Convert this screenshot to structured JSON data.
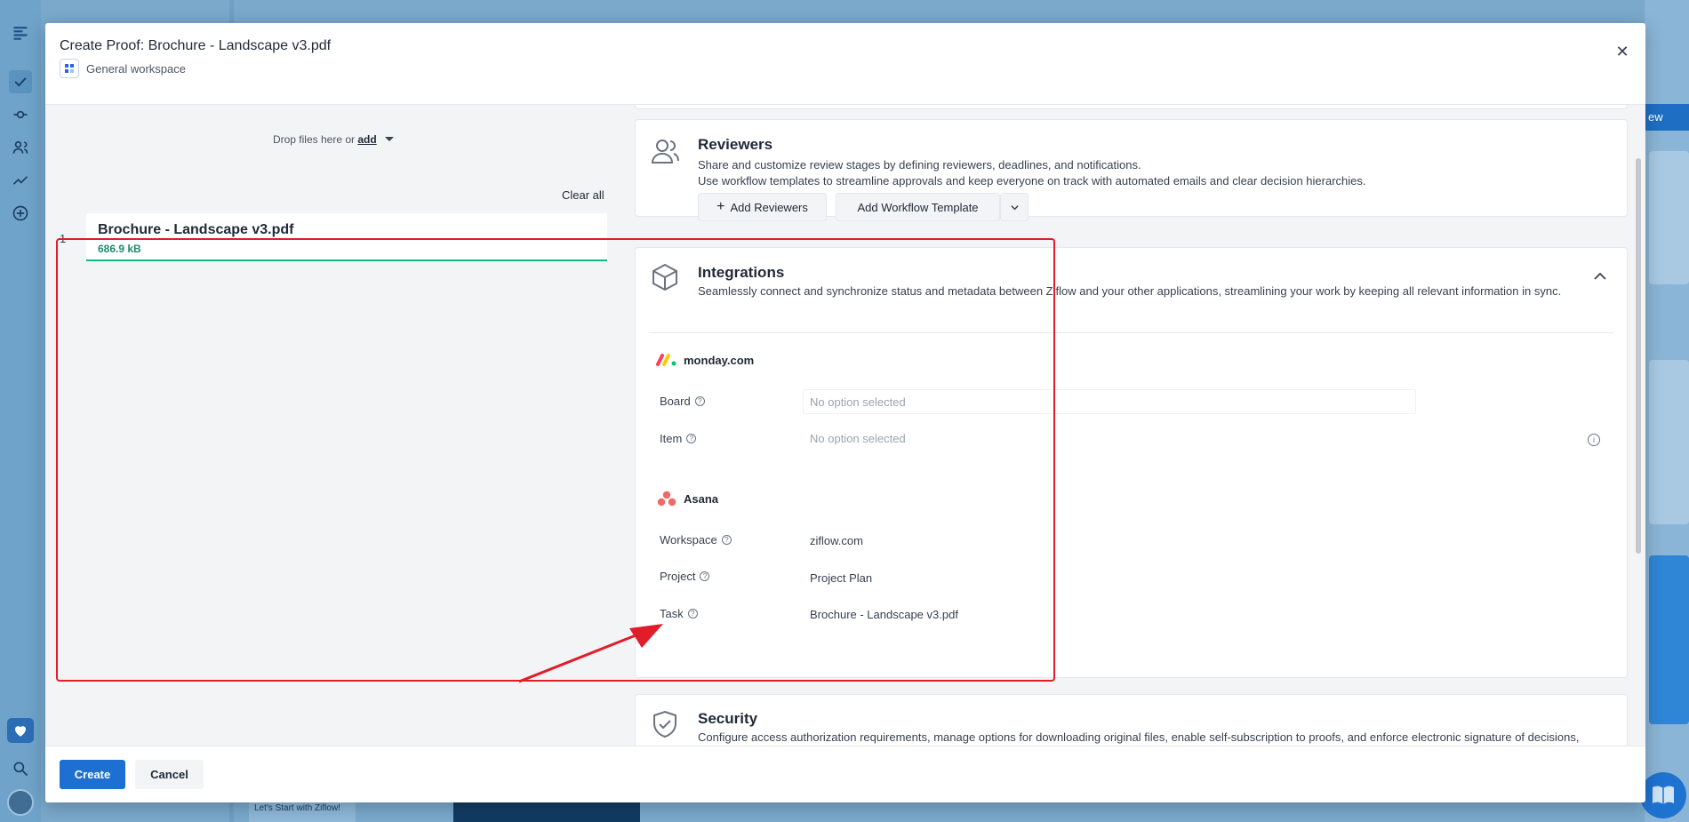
{
  "modal": {
    "title": "Create Proof:  Brochure - Landscape v3.pdf",
    "workspace": "General workspace",
    "close_icon": "close-icon"
  },
  "upload": {
    "drop_text": "Drop files here or",
    "add_link": "add",
    "clear_all": "Clear all",
    "files": [
      {
        "index": "1",
        "name": "Brochure - Landscape v3.pdf",
        "size": "686.9 kB"
      }
    ]
  },
  "reviewers": {
    "title": "Reviewers",
    "desc_line1": "Share and customize review stages by defining reviewers, deadlines, and notifications.",
    "desc_line2": "Use workflow templates to streamline approvals and keep everyone on track with automated emails and clear decision hierarchies.",
    "add_reviewers": "Add Reviewers",
    "add_workflow": "Add Workflow Template"
  },
  "integrations": {
    "title": "Integrations",
    "desc": "Seamlessly connect and synchronize status and metadata between Ziflow and your other applications, streamlining your work by keeping all relevant information in sync.",
    "monday": {
      "name": "monday.com",
      "board_label": "Board",
      "board_value": "No option selected",
      "item_label": "Item",
      "item_value": "No option selected"
    },
    "asana": {
      "name": "Asana",
      "workspace_label": "Workspace",
      "workspace_value": "ziflow.com",
      "project_label": "Project",
      "project_value": "Project Plan",
      "task_label": "Task",
      "task_value": "Brochure - Landscape v3.pdf"
    }
  },
  "security": {
    "title": "Security",
    "desc": "Configure access authorization requirements, manage options for downloading original files, enable self-subscription to proofs, and enforce electronic signature of decisions, ensuring a secure and compliant review process."
  },
  "footer": {
    "create": "Create",
    "cancel": "Cancel"
  },
  "background": {
    "view_button": "ew",
    "bottom_tile_text": "Let's Start with Ziflow!"
  },
  "colors": {
    "primary": "#1d6fd1",
    "highlight": "#e11d2a",
    "success": "#10b981"
  }
}
